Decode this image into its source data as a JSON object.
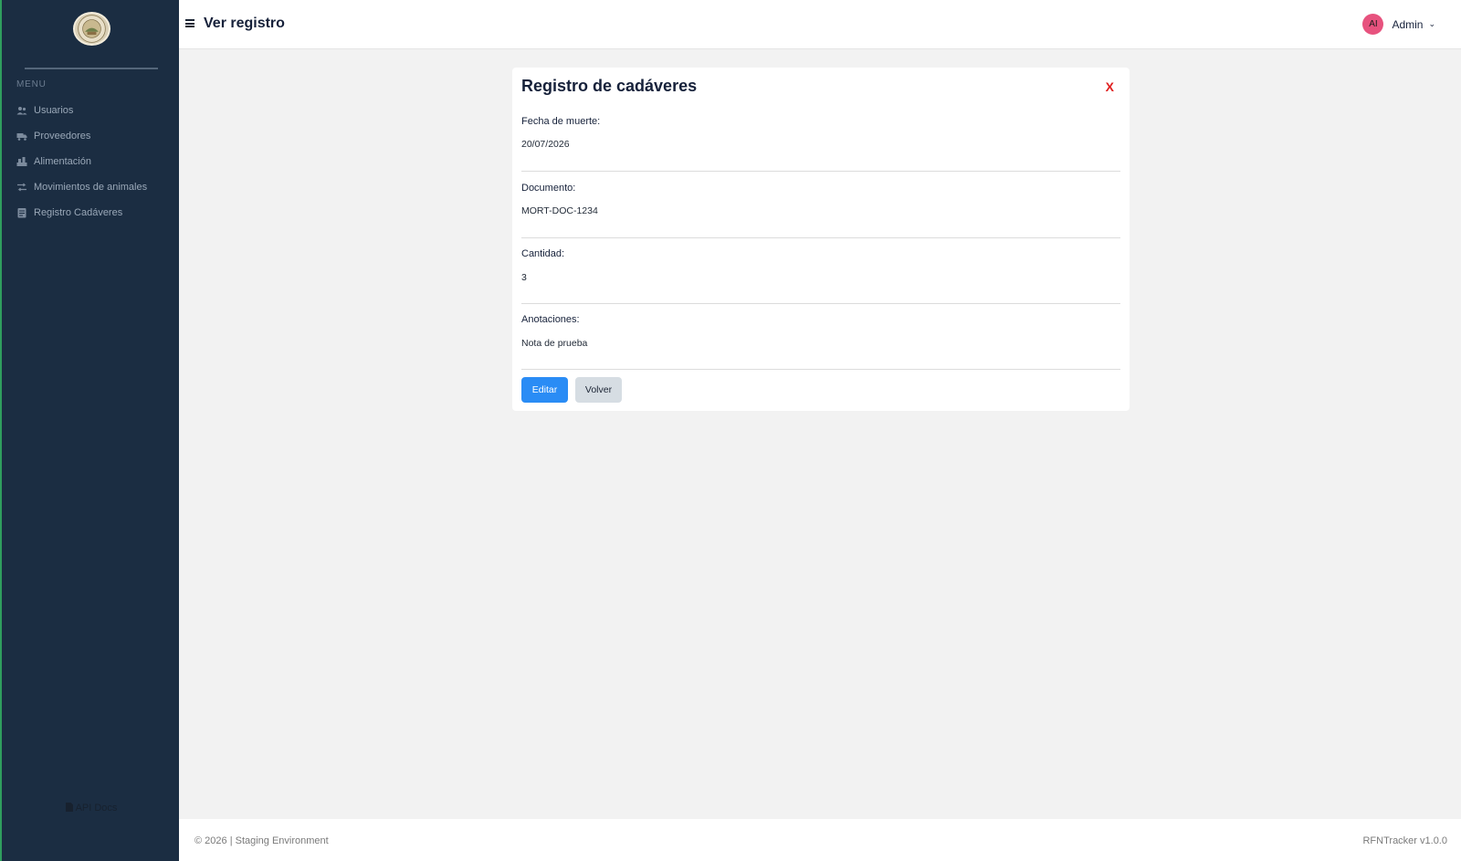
{
  "sidebar": {
    "menu_label": "MENU",
    "items": [
      {
        "label": "Usuarios",
        "icon": "users-icon"
      },
      {
        "label": "Proveedores",
        "icon": "truck-icon"
      },
      {
        "label": "Alimentación",
        "icon": "feed-icon"
      },
      {
        "label": "Movimientos de animales",
        "icon": "swap-arrows-icon"
      },
      {
        "label": "Registro Cadáveres",
        "icon": "clipboard-icon"
      }
    ],
    "api_docs": "API Docs"
  },
  "header": {
    "title": "Ver registro",
    "user": {
      "initials": "AI",
      "name": "Admin"
    }
  },
  "card": {
    "title": "Registro de cadáveres",
    "close_label": "X",
    "fields": [
      {
        "label": "Fecha de muerte:",
        "value": "20/07/2026"
      },
      {
        "label": "Documento:",
        "value": "MORT-DOC-1234"
      },
      {
        "label": "Cantidad:",
        "value": "3"
      },
      {
        "label": "Anotaciones:",
        "value": "Nota de prueba"
      }
    ],
    "edit_label": "Editar",
    "back_label": "Volver"
  },
  "footer": {
    "left": "© 2026 | Staging Environment",
    "right": "RFNTracker v1.0.0"
  },
  "colors": {
    "sidebar_bg": "#1b2d42",
    "accent_blue": "#2a8cf5",
    "close_red": "#e02020",
    "avatar_pink": "#e7527e"
  }
}
